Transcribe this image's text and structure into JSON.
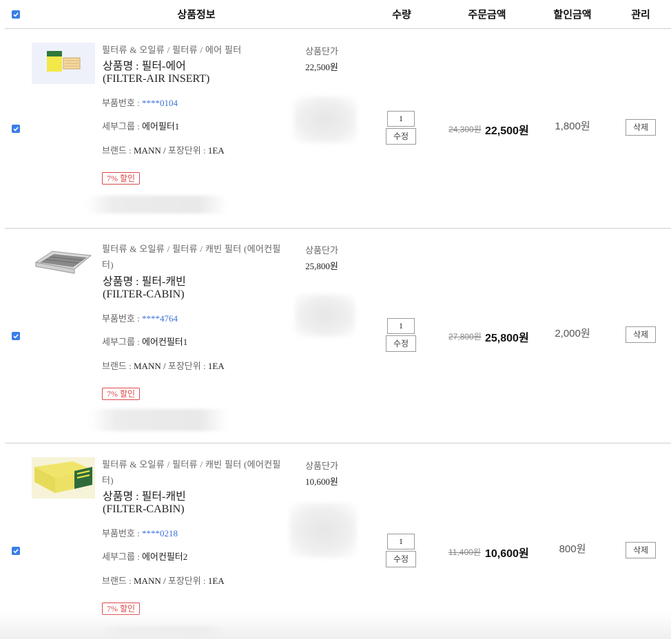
{
  "header": {
    "product_info": "상품정보",
    "quantity": "수량",
    "order_amount": "주문금액",
    "discount_amount": "할인금액",
    "manage": "관리",
    "select_all_checked": true
  },
  "labels": {
    "unit_price": "상품단가",
    "name_prefix": "상품명 : ",
    "part_no": "부품번호 : ",
    "subgroup": "세부그룹 : ",
    "brand": "브랜드 : ",
    "pack_sep": " / ",
    "pack_unit": "포장단위 : ",
    "edit": "수정",
    "delete": "삭제"
  },
  "items": [
    {
      "checked": true,
      "thumb_icon": "air-filter-product-image",
      "category": "필터류 & 오일류 / 필터류 / 에어 필터",
      "name": "필터-에어",
      "name_en": "(FILTER-AIR INSERT)",
      "part_number": "****0104",
      "subgroup": "에어필터1",
      "brand": "MANN",
      "pack_unit": "1EA",
      "badge": "7% 할인",
      "unit_price": "22,500원",
      "qty": "1",
      "price_old": "24,300원",
      "price_new": "22,500원",
      "discount": "1,800원"
    },
    {
      "checked": true,
      "thumb_icon": "cabin-filter-product-image",
      "category": "필터류 & 오일류 / 필터류 / 캐빈 필터 (에어컨필터)",
      "name": "필터-캐빈",
      "name_en": "(FILTER-CABIN)",
      "part_number": "****4764",
      "subgroup": "에어컨필터1",
      "brand": "MANN",
      "pack_unit": "1EA",
      "badge": "7% 할인",
      "unit_price": "25,800원",
      "qty": "1",
      "price_old": "27,800원",
      "price_new": "25,800원",
      "discount": "2,000원"
    },
    {
      "checked": true,
      "thumb_icon": "cabin-filter-box-product-image",
      "category": "필터류 & 오일류 / 필터류 / 캐빈 필터 (에어컨필터)",
      "name": "필터-캐빈",
      "name_en": "(FILTER-CABIN)",
      "part_number": "****0218",
      "subgroup": "에어컨필터2",
      "brand": "MANN",
      "pack_unit": "1EA",
      "badge": "7% 할인",
      "unit_price": "10,600원",
      "qty": "1",
      "price_old": "11,400원",
      "price_new": "10,600원",
      "discount": "800원"
    }
  ],
  "colors": {
    "accent_blue": "#3b7ee6",
    "badge_red": "#d94a4a",
    "part_no_blue": "#3b73d9"
  }
}
